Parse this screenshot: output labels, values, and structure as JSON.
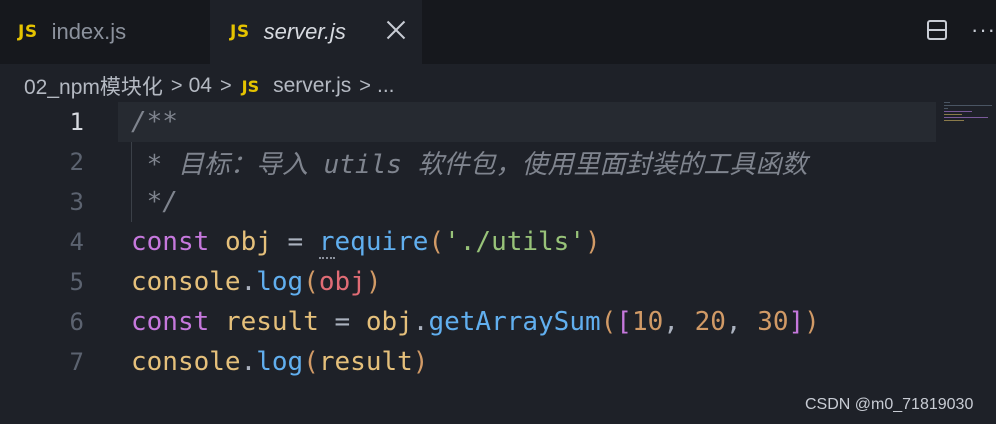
{
  "tabs": [
    {
      "icon": "JS",
      "label": "index.js"
    },
    {
      "icon": "JS",
      "label": "server.js"
    }
  ],
  "breadcrumb": {
    "folder1": "02_npm模块化",
    "folder2": "04",
    "file_icon": "JS",
    "file": "server.js",
    "more": "..."
  },
  "editor": {
    "line_numbers": [
      "1",
      "2",
      "3",
      "4",
      "5",
      "6",
      "7"
    ],
    "active_line": "1",
    "lines": {
      "l1": "/**",
      "l2": " * 目标：导入 utils 软件包，使用里面封装的工具函数",
      "l3": " */",
      "l4": {
        "kw": "const",
        "name": "obj",
        "eq": " = ",
        "fn1": "r",
        "fn2": "equire",
        "p1": "(",
        "str": "'./utils'",
        "p2": ")"
      },
      "l5": {
        "obj": "console",
        "dot": ".",
        "fn": "log",
        "p1": "(",
        "arg": "obj",
        "p2": ")"
      },
      "l6": {
        "kw": "const",
        "name": "result",
        "eq": " = ",
        "obj": "obj",
        "dot": ".",
        "fn": "getArraySum",
        "p1": "(",
        "b1": "[",
        "n1": "10",
        ",1": ", ",
        "n2": "20",
        ",2": ", ",
        "n3": "30",
        "b2": "]",
        "p2": ")"
      },
      "l7": {
        "obj": "console",
        "dot": ".",
        "fn": "log",
        "p1": "(",
        "arg": "result",
        "p2": ")"
      }
    }
  },
  "watermark": "CSDN @m0_71819030",
  "colors": {
    "keyword": "#c678dd",
    "function": "#61afef",
    "string": "#98c379",
    "number": "#d19a66",
    "variable": "#e5c07b",
    "comment": "#7f848e",
    "js_icon": "#e5c300"
  },
  "icons": [
    "close-icon",
    "split-editor-icon",
    "more-actions-icon",
    "chevron-right-icon",
    "js-file-icon"
  ]
}
